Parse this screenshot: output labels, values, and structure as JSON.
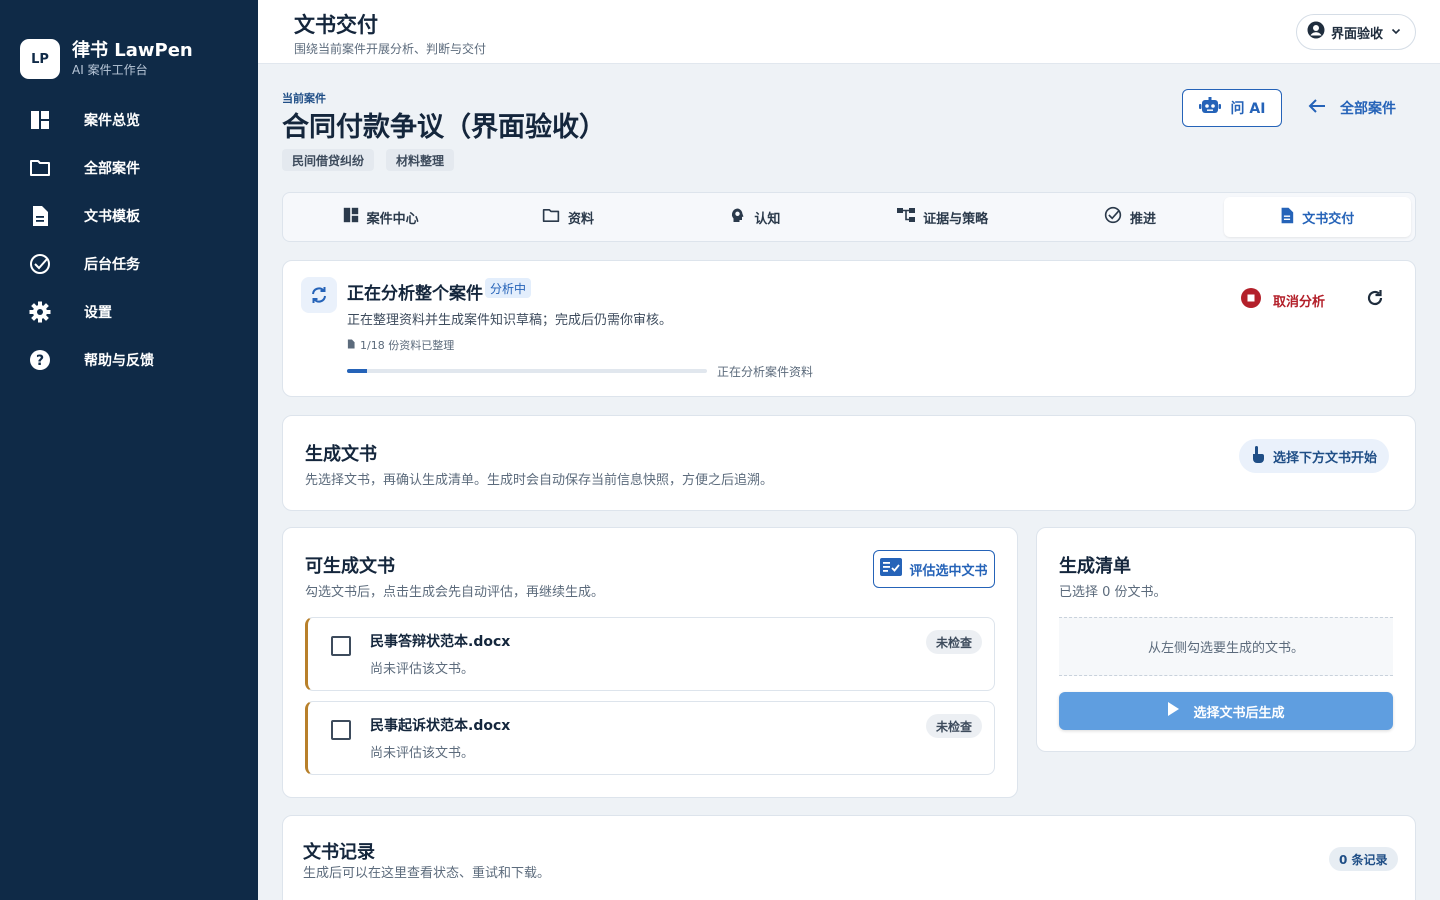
{
  "brand": {
    "logo": "LP",
    "name": "律书 LawPen",
    "subtitle": "AI 案件工作台"
  },
  "sidebar": {
    "items": [
      {
        "label": "案件总览",
        "icon": "dashboard-icon"
      },
      {
        "label": "全部案件",
        "icon": "folder-icon"
      },
      {
        "label": "文书模板",
        "icon": "document-icon"
      },
      {
        "label": "后台任务",
        "icon": "check-circle-icon"
      },
      {
        "label": "设置",
        "icon": "gear-icon"
      },
      {
        "label": "帮助与反馈",
        "icon": "help-icon"
      }
    ]
  },
  "header": {
    "title": "文书交付",
    "subtitle": "围绕当前案件开展分析、判断与交付",
    "user_label": "界面验收"
  },
  "case": {
    "label": "当前案件",
    "title": "合同付款争议（界面验收）",
    "tags": [
      "民间借贷纠纷",
      "材料整理"
    ],
    "ask_ai": "问 AI",
    "all_cases": "全部案件"
  },
  "tabs": [
    {
      "label": "案件中心",
      "icon": "dashboard-icon"
    },
    {
      "label": "资料",
      "icon": "folder-icon"
    },
    {
      "label": "认知",
      "icon": "brain-icon"
    },
    {
      "label": "证据与策略",
      "icon": "hierarchy-icon"
    },
    {
      "label": "推进",
      "icon": "check-circle-icon"
    },
    {
      "label": "文书交付",
      "icon": "document-icon",
      "active": true
    }
  ],
  "analysis": {
    "title": "正在分析整个案件",
    "badge": "分析中",
    "desc": "正在整理资料并生成案件知识草稿；完成后仍需你审核。",
    "count": "1/18 份资料已整理",
    "progress": 0.056,
    "progress_text": "正在分析案件资料",
    "cancel": "取消分析"
  },
  "generate": {
    "title": "生成文书",
    "subtitle": "先选择文书，再确认生成清单。生成时会自动保存当前信息快照，方便之后追溯。",
    "hint": "选择下方文书开始"
  },
  "docs": {
    "title": "可生成文书",
    "subtitle": "勾选文书后，点击生成会先自动评估，再继续生成。",
    "eval_button": "评估选中文书",
    "items": [
      {
        "name": "民事答辩状范本.docx",
        "status": "尚未评估该文书。",
        "badge": "未检查"
      },
      {
        "name": "民事起诉状范本.docx",
        "status": "尚未评估该文书。",
        "badge": "未检查"
      }
    ]
  },
  "checklist": {
    "title": "生成清单",
    "subtitle": "已选择 0 份文书。",
    "empty": "从左侧勾选要生成的文书。",
    "button": "选择文书后生成"
  },
  "records": {
    "title": "文书记录",
    "subtitle": "生成后可以在这里查看状态、重试和下载。",
    "badge": "0 条记录"
  },
  "colors": {
    "sidebar": "#0f2a47",
    "accent": "#2563b8",
    "danger": "#b3202a",
    "doc_accent": "#b8802a"
  }
}
